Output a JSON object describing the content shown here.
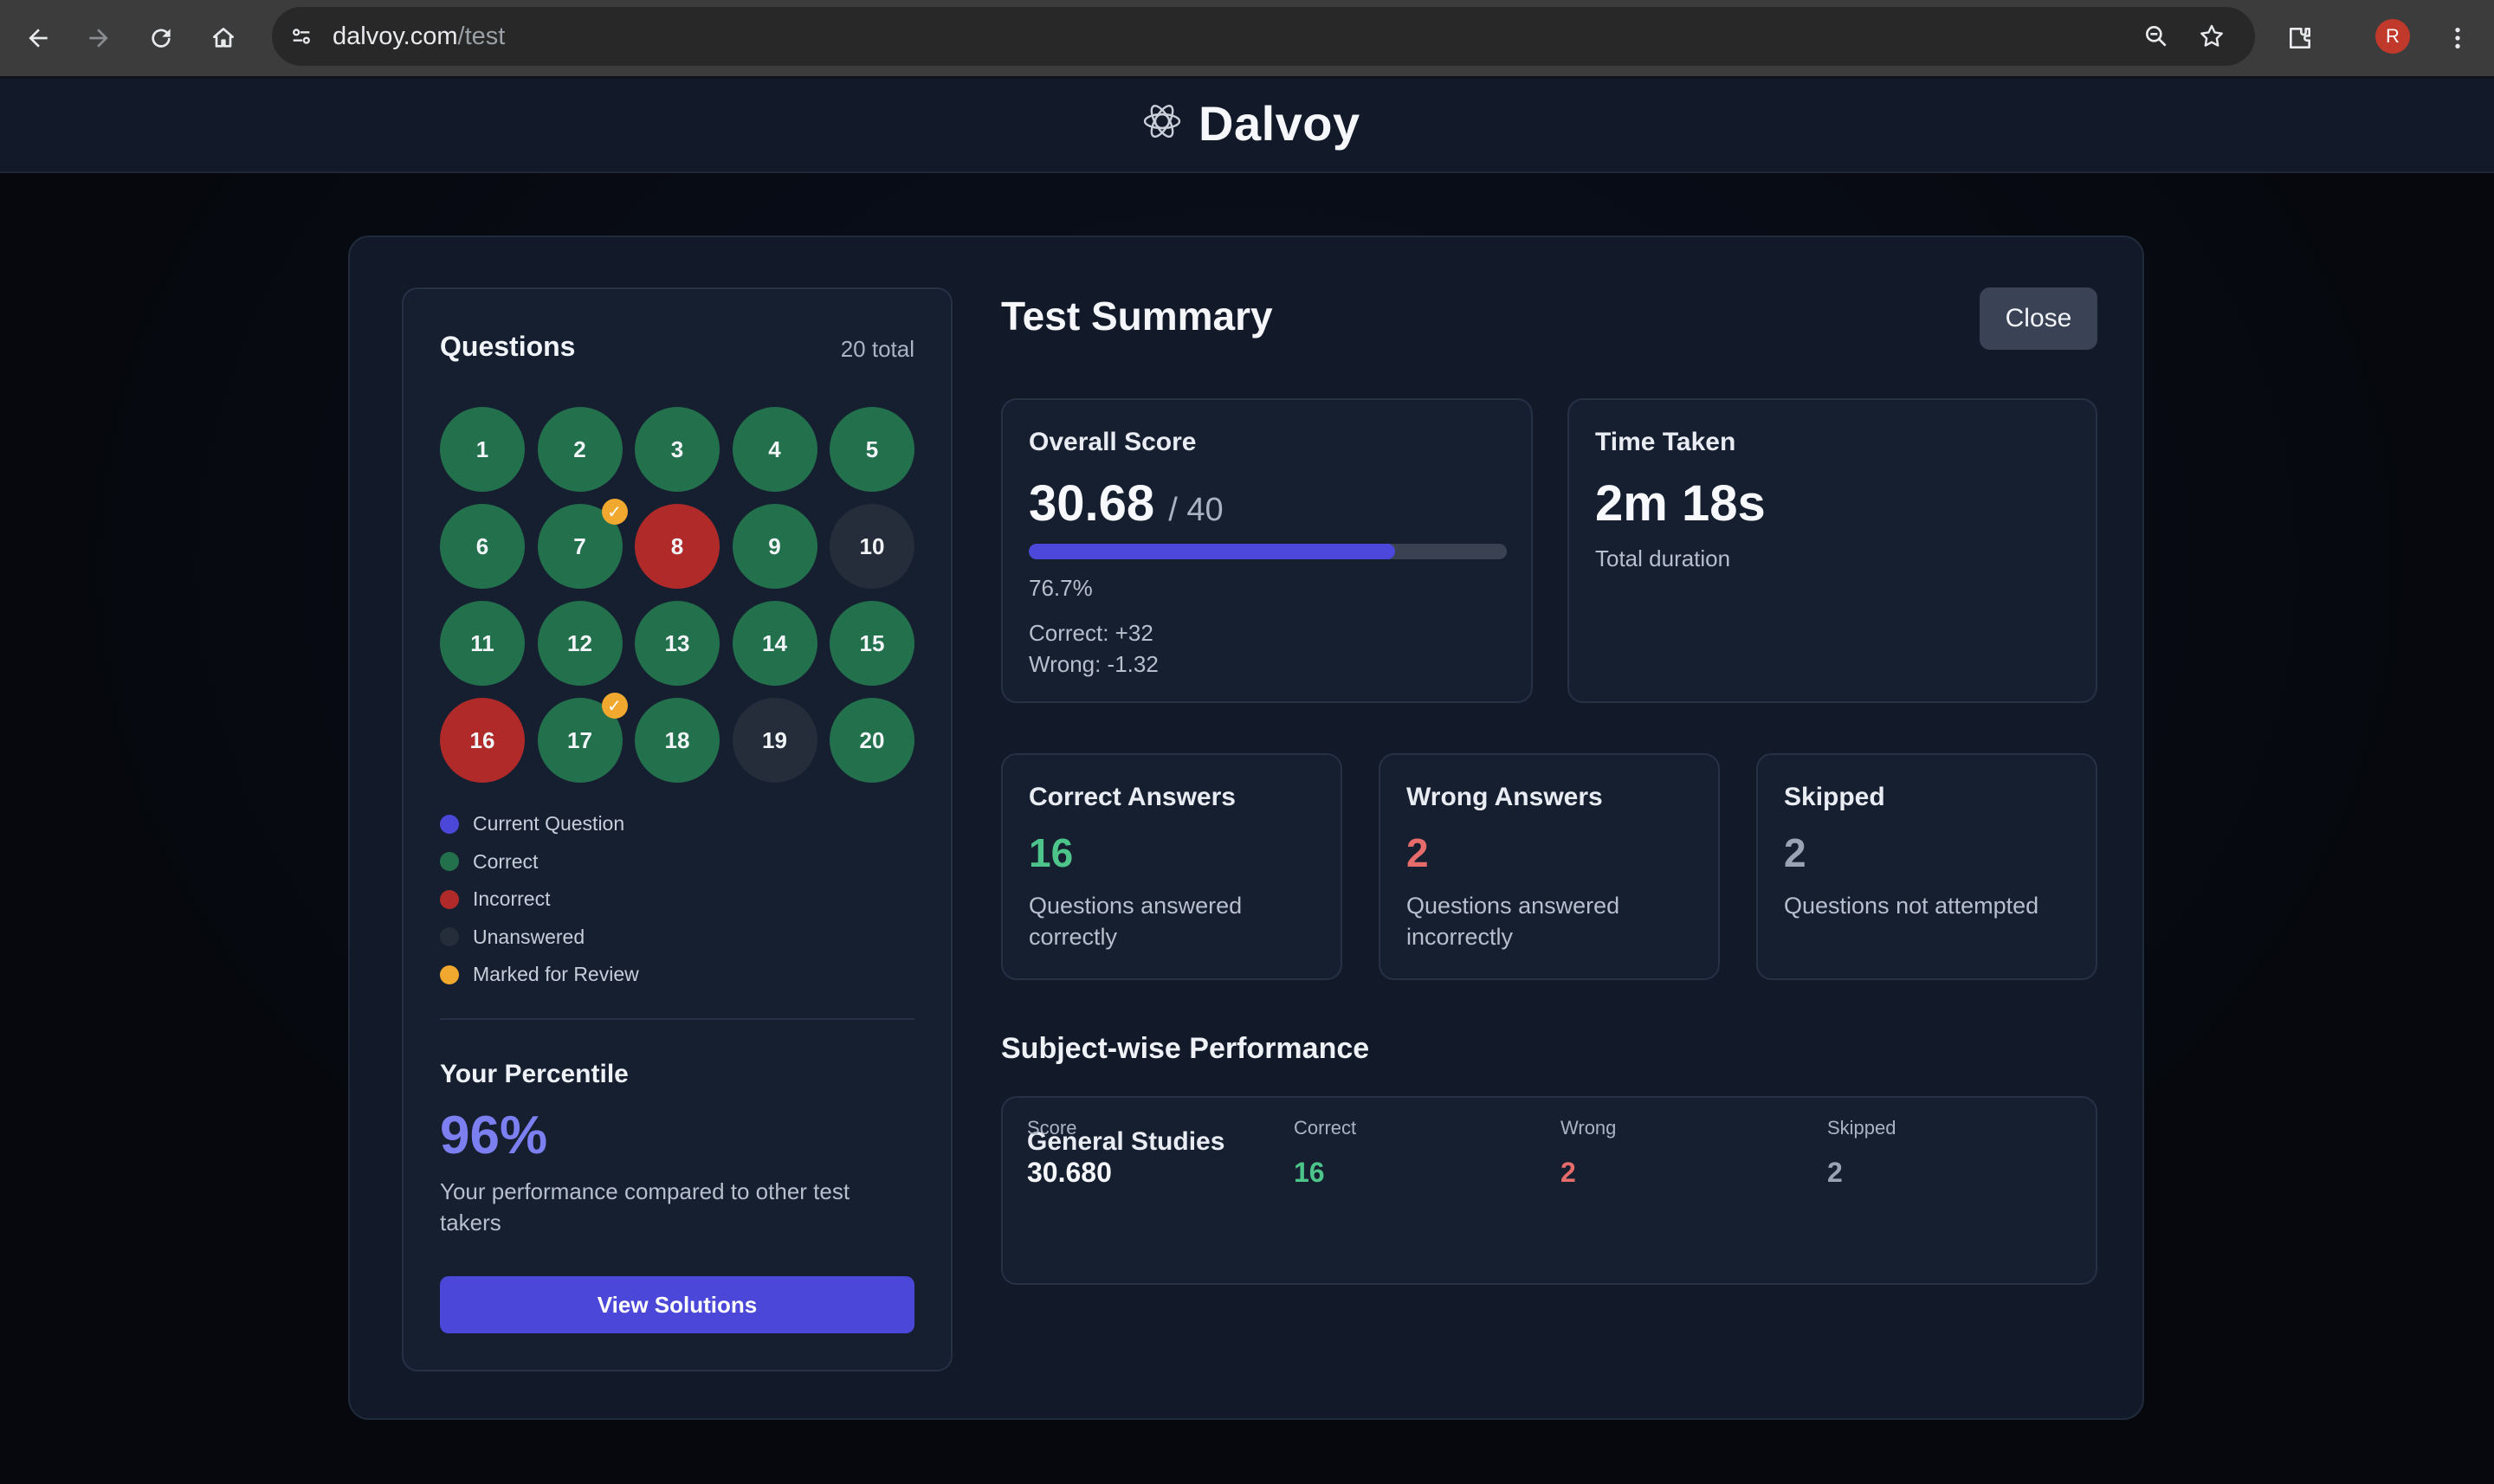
{
  "browser": {
    "url_host": "dalvoy.com",
    "url_path": "/test",
    "profile_initial": "R"
  },
  "site": {
    "brand": "Dalvoy"
  },
  "questions_panel": {
    "title": "Questions",
    "total": "20 total",
    "items": [
      {
        "num": "1",
        "status": "correct",
        "marked": false
      },
      {
        "num": "2",
        "status": "correct",
        "marked": false
      },
      {
        "num": "3",
        "status": "correct",
        "marked": false
      },
      {
        "num": "4",
        "status": "correct",
        "marked": false
      },
      {
        "num": "5",
        "status": "correct",
        "marked": false
      },
      {
        "num": "6",
        "status": "correct",
        "marked": false
      },
      {
        "num": "7",
        "status": "correct",
        "marked": true
      },
      {
        "num": "8",
        "status": "incorrect",
        "marked": false
      },
      {
        "num": "9",
        "status": "correct",
        "marked": false
      },
      {
        "num": "10",
        "status": "unanswered",
        "marked": false
      },
      {
        "num": "11",
        "status": "correct",
        "marked": false
      },
      {
        "num": "12",
        "status": "correct",
        "marked": false
      },
      {
        "num": "13",
        "status": "correct",
        "marked": false
      },
      {
        "num": "14",
        "status": "correct",
        "marked": false
      },
      {
        "num": "15",
        "status": "correct",
        "marked": false
      },
      {
        "num": "16",
        "status": "incorrect",
        "marked": false
      },
      {
        "num": "17",
        "status": "correct",
        "marked": true
      },
      {
        "num": "18",
        "status": "correct",
        "marked": false
      },
      {
        "num": "19",
        "status": "unanswered",
        "marked": false
      },
      {
        "num": "20",
        "status": "correct",
        "marked": false
      }
    ],
    "legend": [
      {
        "label": "Current Question",
        "color": "#4b47d8"
      },
      {
        "label": "Correct",
        "color": "#23704d"
      },
      {
        "label": "Incorrect",
        "color": "#b02a2a"
      },
      {
        "label": "Unanswered",
        "color": "#252c3a"
      },
      {
        "label": "Marked for Review",
        "color": "#f0a82e"
      }
    ],
    "percentile": {
      "title": "Your Percentile",
      "value": "96%",
      "description": "Your performance compared to other test takers"
    },
    "view_solutions_label": "View Solutions"
  },
  "summary": {
    "title": "Test Summary",
    "close_label": "Close",
    "overall": {
      "title": "Overall Score",
      "score": "30.68",
      "max": "/ 40",
      "fraction": 0.767,
      "percent": "76.7%",
      "correct_line": "Correct: +32",
      "wrong_line": "Wrong: -1.32"
    },
    "time": {
      "title": "Time Taken",
      "value": "2m 18s",
      "caption": "Total duration"
    },
    "correct": {
      "title": "Correct Answers",
      "value": "16",
      "desc": "Questions answered correctly",
      "color": "#4cc48a"
    },
    "wrong": {
      "title": "Wrong Answers",
      "value": "2",
      "desc": "Questions answered incorrectly",
      "color": "#e66b6b"
    },
    "skipped": {
      "title": "Skipped",
      "value": "2",
      "desc": "Questions not attempted",
      "color": "#9aa3b2"
    }
  },
  "subject_performance": {
    "title": "Subject-wise Performance",
    "subject": "General Studies",
    "labels": {
      "score": "Score",
      "correct": "Correct",
      "wrong": "Wrong",
      "skipped": "Skipped"
    },
    "values": {
      "score": "30.680",
      "correct": "16",
      "wrong": "2",
      "skipped": "2"
    }
  }
}
